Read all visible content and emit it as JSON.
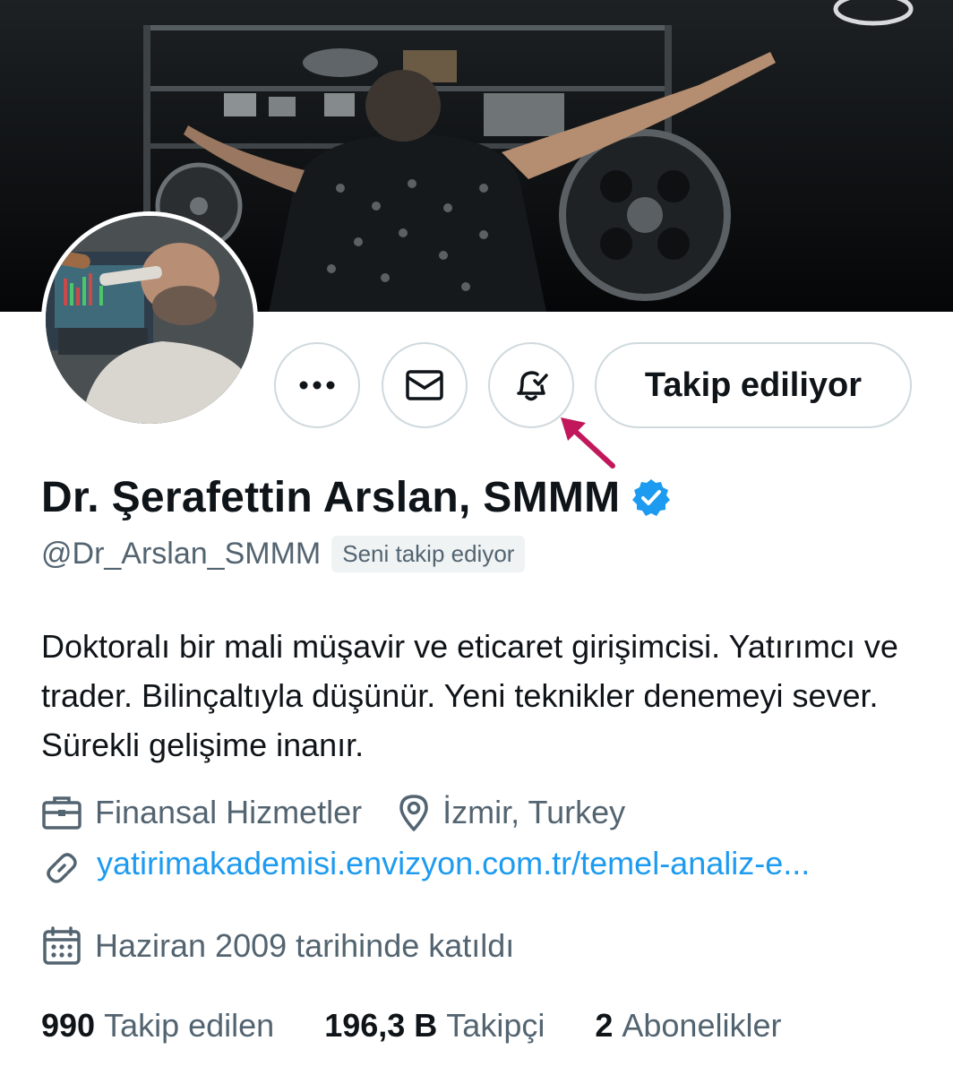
{
  "profile": {
    "name": "Dr. Şerafettin Arslan, SMMM",
    "handle": "@Dr_Arslan_SMMM",
    "follows_you_badge": "Seni takip ediyor",
    "bio": "Doktoralı bir mali müşavir ve eticaret girişimcisi. Yatırımcı ve trader. Bilinçaltıyla düşünür. Yeni teknikler denemeyi sever. Sürekli gelişime inanır.",
    "category": "Finansal Hizmetler",
    "location": "İzmir, Turkey",
    "website": "yatirimakademisi.envizyon.com.tr/temel-analiz-e...",
    "joined": "Haziran 2009 tarihinde katıldı"
  },
  "actions": {
    "follow_button": "Takip ediliyor"
  },
  "stats": {
    "following_count": "990",
    "following_label": "Takip edilen",
    "followers_count": "196,3 B",
    "followers_label": "Takipçi",
    "subscriptions_count": "2",
    "subscriptions_label": "Abonelikler"
  },
  "icons": {
    "more": "more-dots-icon",
    "mail": "envelope-icon",
    "bell": "bell-subscribed-icon",
    "verified": "verified-badge-icon",
    "category": "briefcase-icon",
    "location": "location-pin-icon",
    "website": "link-icon",
    "joined": "calendar-icon",
    "annotation": "annotation-arrow-icon"
  },
  "colors": {
    "link": "#1d9bf0",
    "verified": "#1d9bf0",
    "secondary_text": "#536471",
    "annotation_arrow": "#c2185b"
  }
}
